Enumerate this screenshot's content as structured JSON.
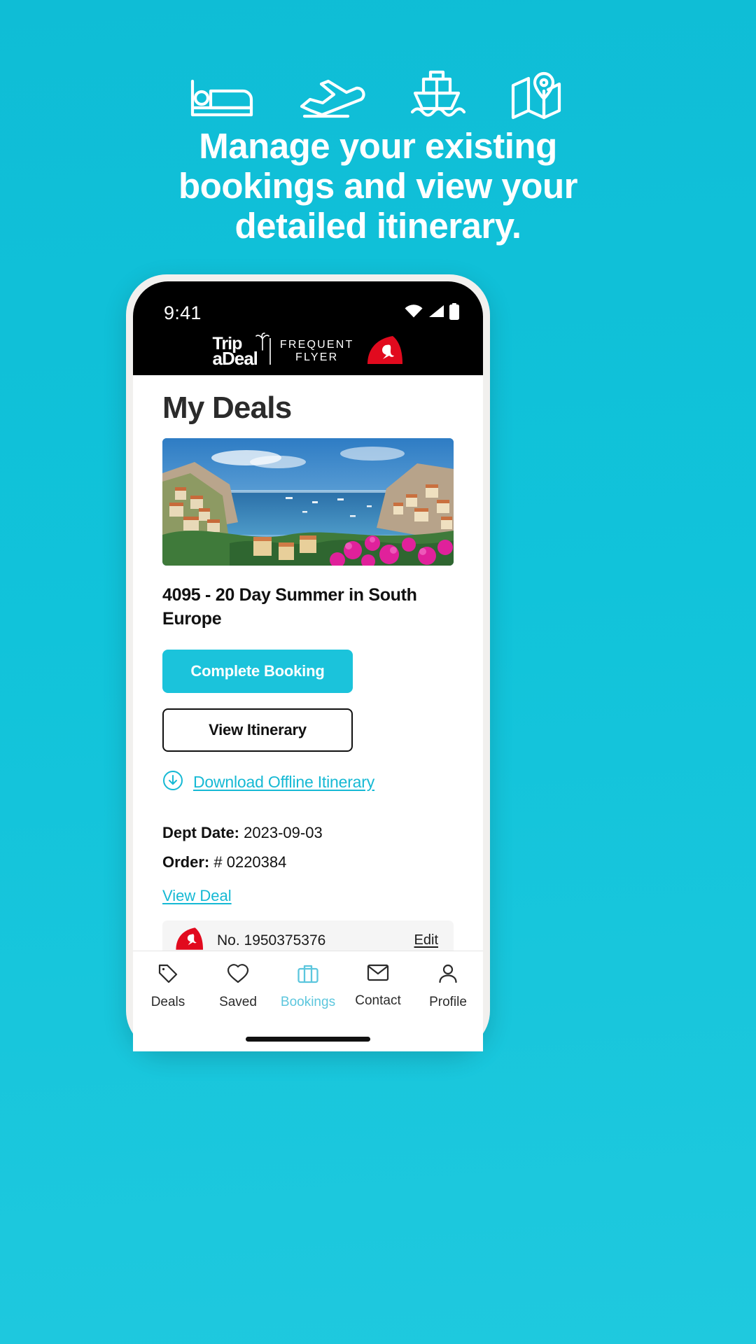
{
  "promo": {
    "icons": [
      "bed-icon",
      "plane-takeoff-icon",
      "cruise-ship-icon",
      "map-pin-icon"
    ],
    "headline_line1": "Manage your existing",
    "headline_line2": "bookings and view your",
    "headline_line3": "detailed itinerary.",
    "background_color": "#11c3da"
  },
  "phone": {
    "statusbar": {
      "time": "9:41",
      "icons": [
        "wifi-icon",
        "cellular-signal-icon",
        "battery-icon"
      ]
    },
    "appbar": {
      "brand_line1": "Trip",
      "brand_line2": "aDeal",
      "partner_line1": "FREQUENT",
      "partner_line2": "FLYER",
      "partner_logo": "qantas-kangaroo-icon"
    },
    "content": {
      "page_title": "My Deals",
      "deal": {
        "image_alt": "positano-amalfi-coast-photo",
        "title": "4095 - 20 Day Summer in South Europe",
        "primary_button": "Complete Booking",
        "secondary_button": "View Itinerary",
        "download_link": "Download Offline Itinerary",
        "download_icon": "download-circle-icon",
        "dept_date_label": "Dept Date:",
        "dept_date_value": "2023-09-03",
        "order_label": "Order:",
        "order_value": "# 0220384",
        "view_deal_link": "View Deal",
        "frequent_flyer": {
          "airline_icon": "qantas-kangaroo-icon",
          "number": "No. 1950375376",
          "edit_label": "Edit"
        }
      }
    },
    "tabbar": {
      "active_color": "#5cc6dd",
      "items": [
        {
          "label": "Deals",
          "icon": "tag-icon",
          "active": false
        },
        {
          "label": "Saved",
          "icon": "heart-icon",
          "active": false
        },
        {
          "label": "Bookings",
          "icon": "briefcase-icon",
          "active": true
        },
        {
          "label": "Contact",
          "icon": "envelope-icon",
          "active": false
        },
        {
          "label": "Profile",
          "icon": "person-icon",
          "active": false
        }
      ]
    }
  },
  "colors": {
    "brand_teal": "#11c3da",
    "button_teal": "#1bc3db",
    "link_teal": "#16b9d4",
    "qantas_red": "#e10a1e"
  }
}
